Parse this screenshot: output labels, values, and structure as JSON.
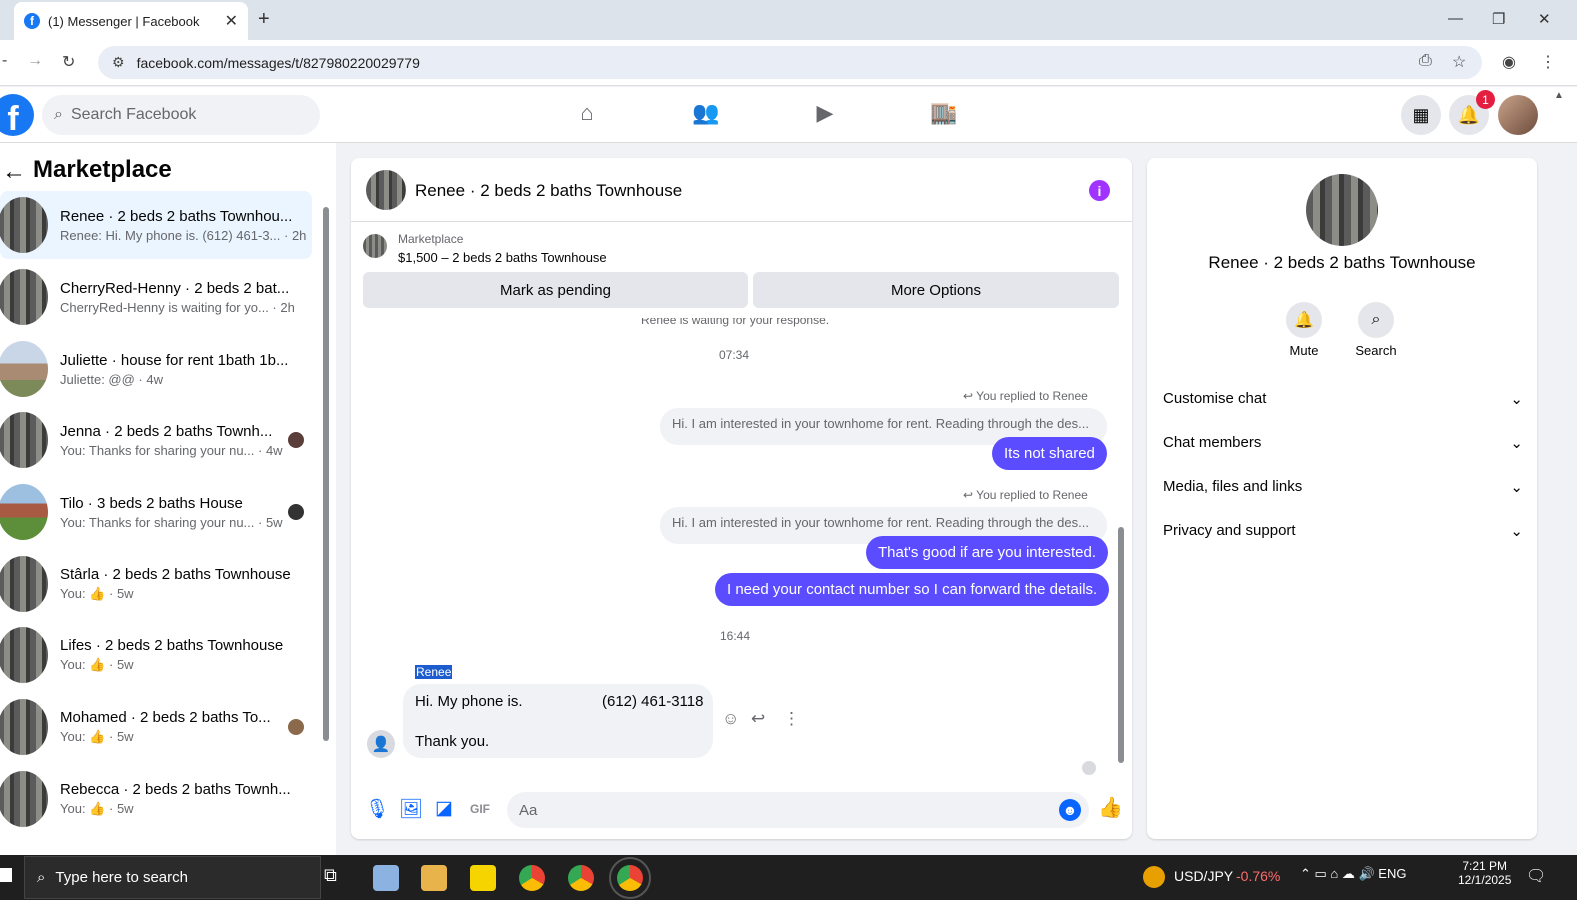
{
  "browser": {
    "tab_title": "(1) Messenger | Facebook",
    "url": "facebook.com/messages/t/827980220029779"
  },
  "header": {
    "search_placeholder": "Search Facebook",
    "notification_count": "1"
  },
  "sidebar": {
    "title": "Marketplace",
    "conversations": [
      {
        "name": "Renee · 2 beds 2 baths Townhou...",
        "preview": "Renee: Hi. My phone is. (612) 461-3... · 2h"
      },
      {
        "name": "CherryRed-Henny · 2 beds 2 bat...",
        "preview": "CherryRed-Henny is waiting for yo... · 2h"
      },
      {
        "name": "Juliette · house for rent 1bath 1b...",
        "preview": "Juliette: @@ · 4w"
      },
      {
        "name": "Jenna · 2 beds 2 baths Townh...",
        "preview": "You: Thanks for sharing your nu... · 4w"
      },
      {
        "name": "Tilo · 3 beds 2 baths House",
        "preview": "You: Thanks for sharing your nu... · 5w"
      },
      {
        "name": "Stârla · 2 beds 2 baths Townhouse",
        "preview_prefix": "You:",
        "preview_suffix": "· 5w"
      },
      {
        "name": "Lifes · 2 beds 2 baths Townhouse",
        "preview_prefix": "You:",
        "preview_suffix": "· 5w"
      },
      {
        "name": "Mohamed · 2 beds 2 baths To...",
        "preview_prefix": "You:",
        "preview_suffix": "· 5w"
      },
      {
        "name": "Rebecca · 2 beds 2 baths Townh...",
        "preview_prefix": "You:",
        "preview_suffix": "· 5w"
      }
    ]
  },
  "chat": {
    "title": "Renee · 2 beds 2 baths Townhouse",
    "listing_label": "Marketplace",
    "listing_price": "$1,500 – 2 beds 2 baths Townhouse",
    "mark_pending": "Mark as pending",
    "more_options": "More Options",
    "waiting_note": "Renee is waiting for your response.",
    "time1": "07:34",
    "replied_label": "You replied to Renee",
    "quoted": "Hi.  I am interested in your townhome for rent.  Reading through the des...",
    "msg1": "Its not shared",
    "msg2": "That's good if are you interested.",
    "msg3": "I need your contact number so I can forward the details.",
    "time2": "16:44",
    "sender": "Renee",
    "incoming_line1": "Hi.  My phone is.",
    "incoming_phone": "(612) 461-3118",
    "incoming_line2": "Thank you.",
    "composer_placeholder": "Aa"
  },
  "info_panel": {
    "name": "Renee · 2 beds 2 baths Townhouse",
    "mute": "Mute",
    "search": "Search",
    "sections": [
      "Customise chat",
      "Chat members",
      "Media, files and links",
      "Privacy and support"
    ]
  },
  "taskbar": {
    "search_placeholder": "Type here to search",
    "ticker": "USD/JPY",
    "ticker_change": "-0.76%",
    "lang": "ENG",
    "time": "7:21 PM",
    "date": "12/1/2025"
  },
  "colors": {
    "accent": "#0866ff",
    "bubble": "#5b4cff",
    "brand": "#1877f2"
  }
}
